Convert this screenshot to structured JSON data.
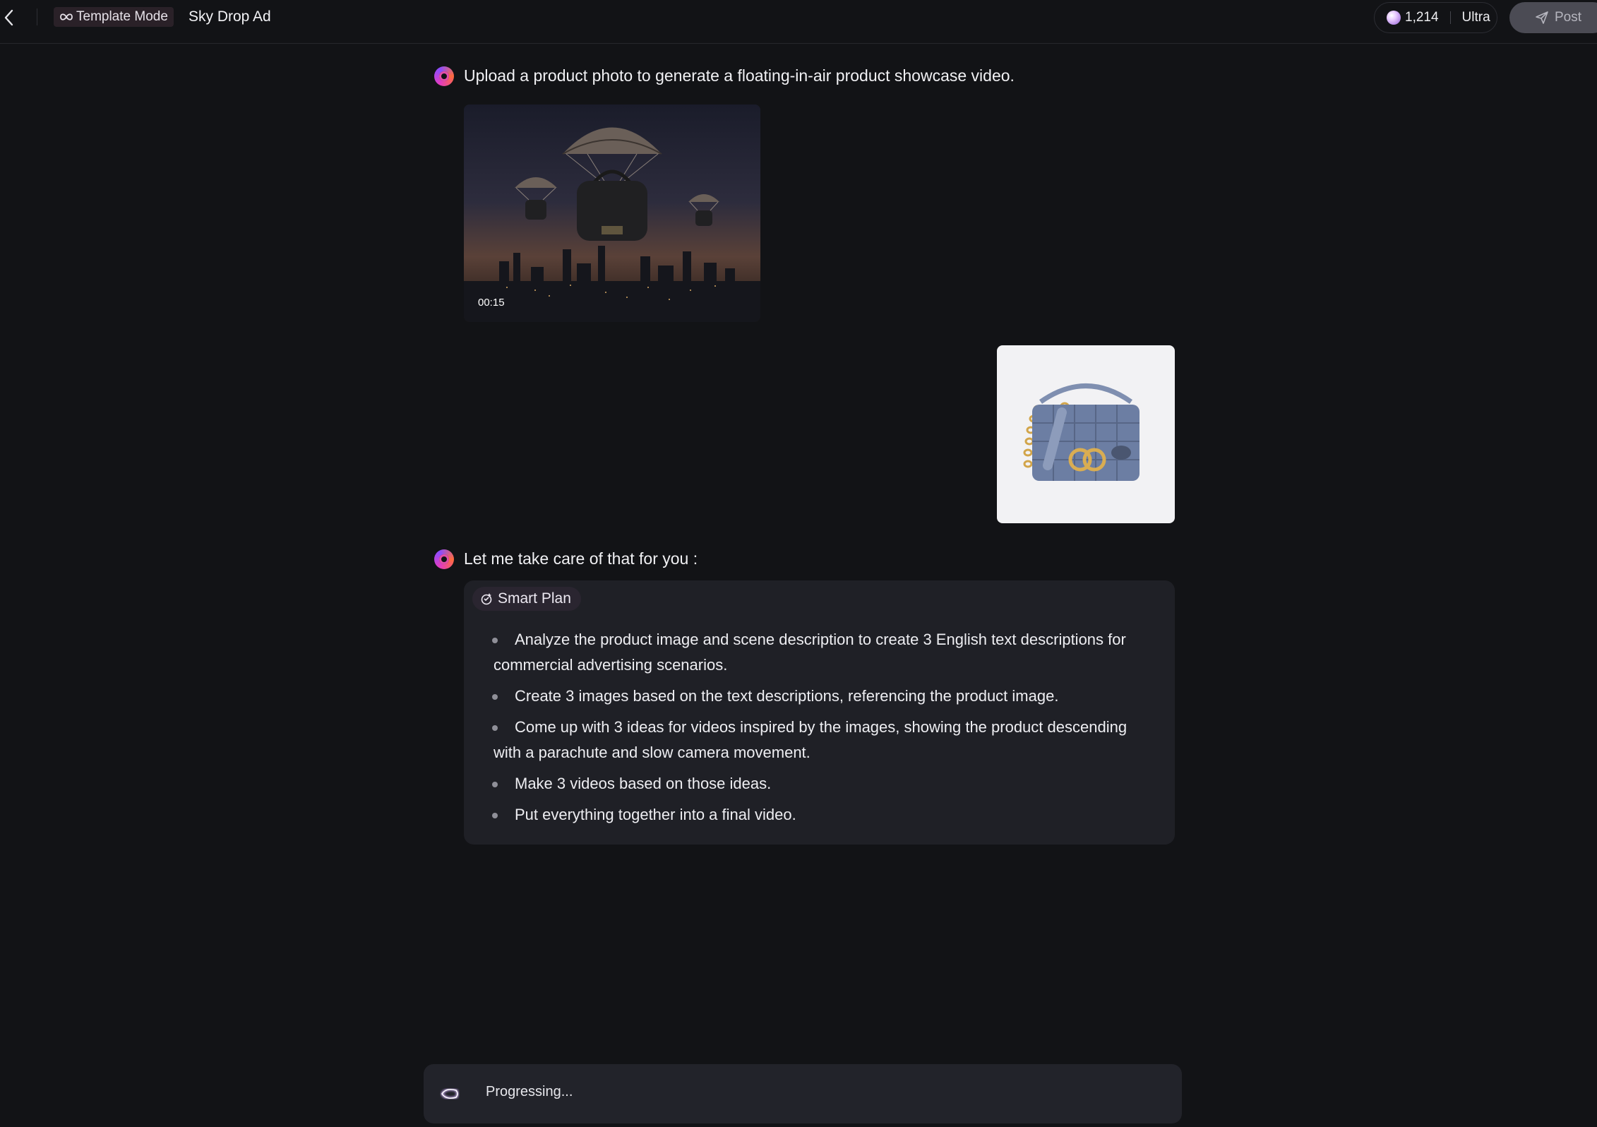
{
  "header": {
    "mode_label": "Template Mode",
    "project_title": "Sky Drop Ad",
    "credits": "1,214",
    "plan_tier": "Ultra",
    "post_label": "Post"
  },
  "chat": {
    "assistant_intro": "Upload a product photo to generate a floating-in-air product showcase video.",
    "video": {
      "duration": "00:15"
    },
    "assistant_reply": "Let me take care of that for you :",
    "plan": {
      "title": "Smart Plan",
      "steps": [
        "Analyze the product image and scene description to create 3 English text descriptions for commercial advertising scenarios.",
        "Create 3 images based on the text descriptions, referencing the product image.",
        "Come up with 3 ideas for videos inspired by the images, showing the product descending with a parachute and slow camera movement.",
        "Make 3 videos based on those ideas.",
        "Put everything together into a final video."
      ]
    }
  },
  "composer": {
    "status_text": "Progressing..."
  },
  "colors": {
    "background": "#121316",
    "card": "#1f2026",
    "accent_pink": "#e24ea8",
    "post_button": "#4b4b54"
  },
  "icons": {
    "back": "chevron-left-icon",
    "mode": "infinity-icon",
    "credits": "gem-icon",
    "post": "send-icon",
    "assistant": "assistant-avatar-icon",
    "smart_plan": "smart-plan-icon",
    "status": "spinner-icon"
  }
}
